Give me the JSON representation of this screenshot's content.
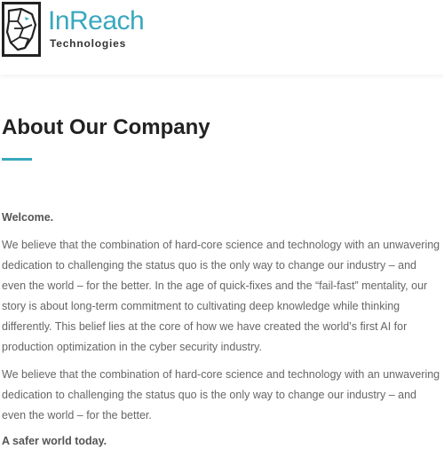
{
  "header": {
    "logo": {
      "name": "InReach",
      "subtitle": "Technologies",
      "icon": "lion-head-icon",
      "brand_color": "#3aa8be"
    }
  },
  "main": {
    "title": "About Our Company",
    "accent_color": "#3aa8be",
    "welcome": "Welcome.",
    "paragraphs": [
      "We believe that the combination of hard-core science and technology with an unwavering dedication to challenging the status quo is the only way to change our industry – and even the world – for the better. In the age of quick-fixes and the “fail-fast” mentality, our story is about long-term commitment to cultivating deep knowledge while thinking differently. This belief lies at the core of how we have created the world’s first AI for production optimization in the cyber security industry.",
      "We believe that the combination of hard-core science and technology with an unwavering dedication to challenging the status quo is the only way to change our industry – and even the world – for the better."
    ],
    "tagline": "A safer world today."
  }
}
